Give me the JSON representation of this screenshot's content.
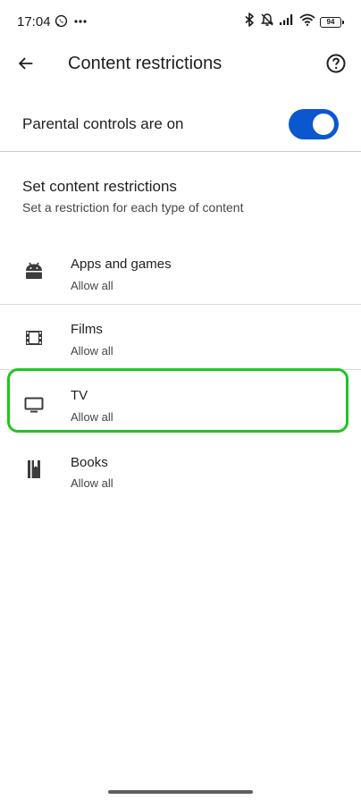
{
  "status_bar": {
    "time": "17:04",
    "left_icons": [
      "whatsapp-icon",
      "more-dots-icon"
    ],
    "right_icons": [
      "bluetooth-icon",
      "notifications-off-icon",
      "signal-icon",
      "wifi-icon",
      "battery-icon"
    ],
    "battery_level": "94"
  },
  "app_bar": {
    "back_icon": "arrow-back-icon",
    "title": "Content restrictions",
    "help_icon": "help-circle-icon"
  },
  "parental_controls": {
    "label": "Parental controls are on",
    "enabled": true
  },
  "restrictions": {
    "title": "Set content restrictions",
    "subtitle": "Set a restriction for each type of content",
    "items": [
      {
        "title": "Apps and games",
        "value": "Allow all",
        "icon": "android-icon"
      },
      {
        "title": "Films",
        "value": "Allow all",
        "icon": "film-icon"
      },
      {
        "title": "TV",
        "value": "Allow all",
        "icon": "tv-icon",
        "highlighted": true
      },
      {
        "title": "Books",
        "value": "Allow all",
        "icon": "book-icon"
      }
    ]
  },
  "colors": {
    "accent": "#0b57d0",
    "highlight": "#22c422",
    "text_primary": "#1f1f1f",
    "text_secondary": "#444746",
    "divider": "#c8c8c8"
  }
}
